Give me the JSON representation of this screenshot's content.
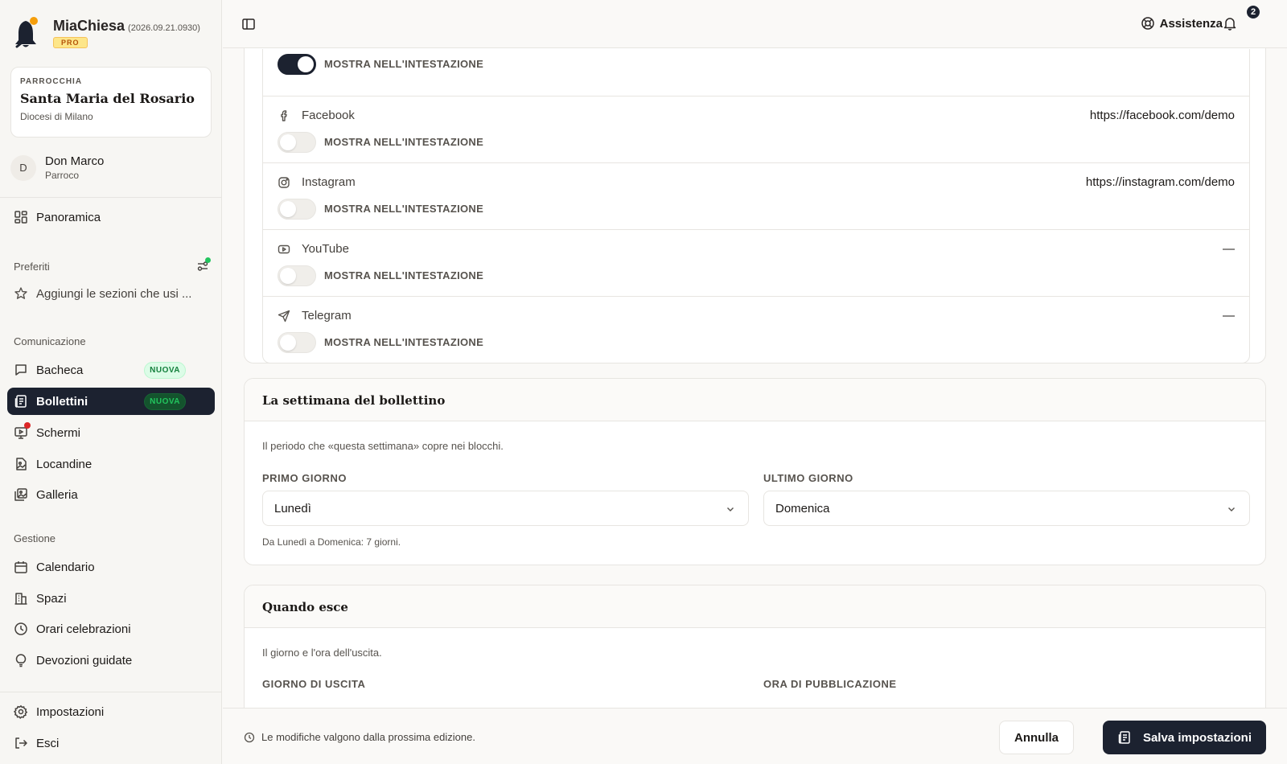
{
  "app": {
    "name": "MiaChiesa",
    "version": "(2026.09.21.0930)",
    "tier": "PRO"
  },
  "parish": {
    "kicker": "PARROCCHIA",
    "name": "Santa Maria del Rosario",
    "diocese": "Diocesi di Milano"
  },
  "user": {
    "initial": "D",
    "name": "Don Marco",
    "role": "Parroco"
  },
  "nav": {
    "overview": "Panoramica",
    "favorites_label": "Preferiti",
    "favorites_add": "Aggiungi le sezioni che usi ...",
    "communication_label": "Comunicazione",
    "board": "Bacheca",
    "bulletins": "Bollettini",
    "screens": "Schermi",
    "posters": "Locandine",
    "gallery": "Galleria",
    "management_label": "Gestione",
    "calendar": "Calendario",
    "spaces": "Spazi",
    "schedules": "Orari celebrazioni",
    "devotions": "Devozioni guidate",
    "settings": "Impostazioni",
    "logout": "Esci",
    "new_badge": "NUOVA"
  },
  "topbar": {
    "help": "Assistenza",
    "notifications": "2"
  },
  "socials": {
    "show_in_header": "MOSTRA NELL'INTESTAZIONE",
    "top_toggle_on": true,
    "rows": [
      {
        "name": "Facebook",
        "value": "https://facebook.com/demo",
        "on": false
      },
      {
        "name": "Instagram",
        "value": "https://instagram.com/demo",
        "on": false
      },
      {
        "name": "YouTube",
        "value": "—",
        "on": false
      },
      {
        "name": "Telegram",
        "value": "—",
        "on": false
      }
    ]
  },
  "week": {
    "title": "La settimana del bollettino",
    "description": "Il periodo che «questa settimana» copre nei blocchi.",
    "first_day_label": "PRIMO GIORNO",
    "first_day_value": "Lunedì",
    "last_day_label": "ULTIMO GIORNO",
    "last_day_value": "Domenica",
    "hint": "Da Lunedì a Domenica: 7 giorni."
  },
  "release": {
    "title": "Quando esce",
    "description": "Il giorno e l'ora dell'uscita.",
    "day_label": "GIORNO DI USCITA",
    "time_label": "ORA DI PUBBLICAZIONE"
  },
  "footer": {
    "note": "Le modifiche valgono dalla prossima edizione.",
    "cancel": "Annulla",
    "save": "Salva impostazioni"
  }
}
